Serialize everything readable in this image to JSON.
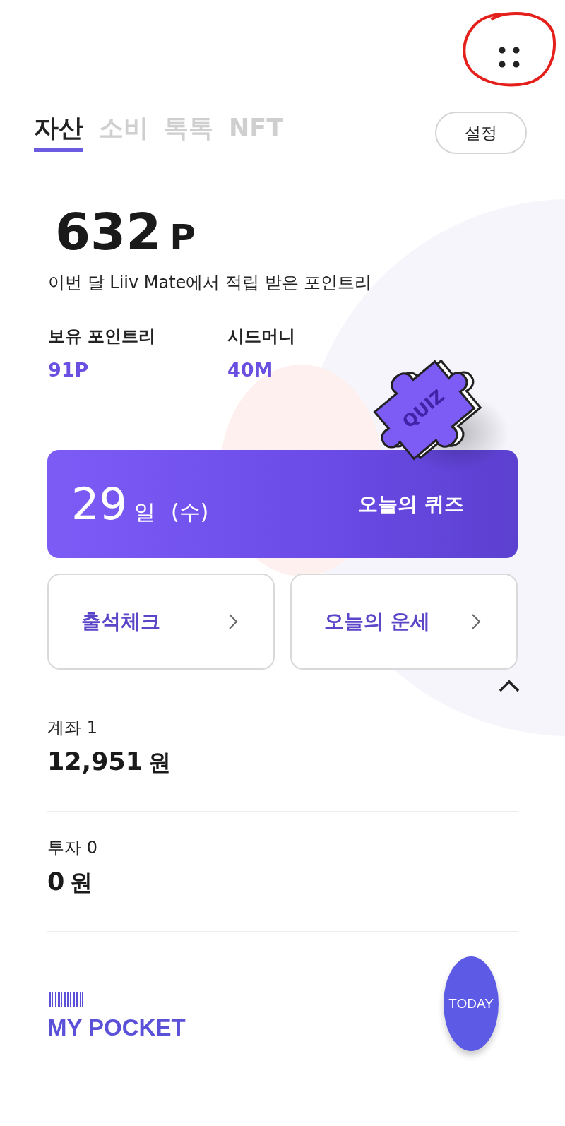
{
  "tabs": [
    {
      "label": "자산",
      "selected": true
    },
    {
      "label": "소비",
      "selected": false
    },
    {
      "label": "톡톡",
      "selected": false
    },
    {
      "label": "NFT",
      "selected": false
    }
  ],
  "settings_button": "설정",
  "points": {
    "amount": "632",
    "unit": "P",
    "description": "이번 달 Liiv Mate에서 적립 받은 포인트리"
  },
  "stats": [
    {
      "label": "보유 포인트리",
      "value": "91P"
    },
    {
      "label": "시드머니",
      "value": "40M"
    }
  ],
  "quiz": {
    "day": "29",
    "day_unit": "일",
    "weekday": "(수)",
    "title": "오늘의 퀴즈",
    "badge": "QUIZ"
  },
  "shortcuts": [
    {
      "label": "출석체크"
    },
    {
      "label": "오늘의 운세"
    }
  ],
  "assets": {
    "expanded": true,
    "sections": [
      {
        "title": "계좌 1",
        "amount": "12,951",
        "unit": "원"
      },
      {
        "title": "투자 0",
        "amount": "0",
        "unit": "원"
      }
    ]
  },
  "pocket": {
    "title": "MY POCKET"
  },
  "today_button": "TODAY"
}
